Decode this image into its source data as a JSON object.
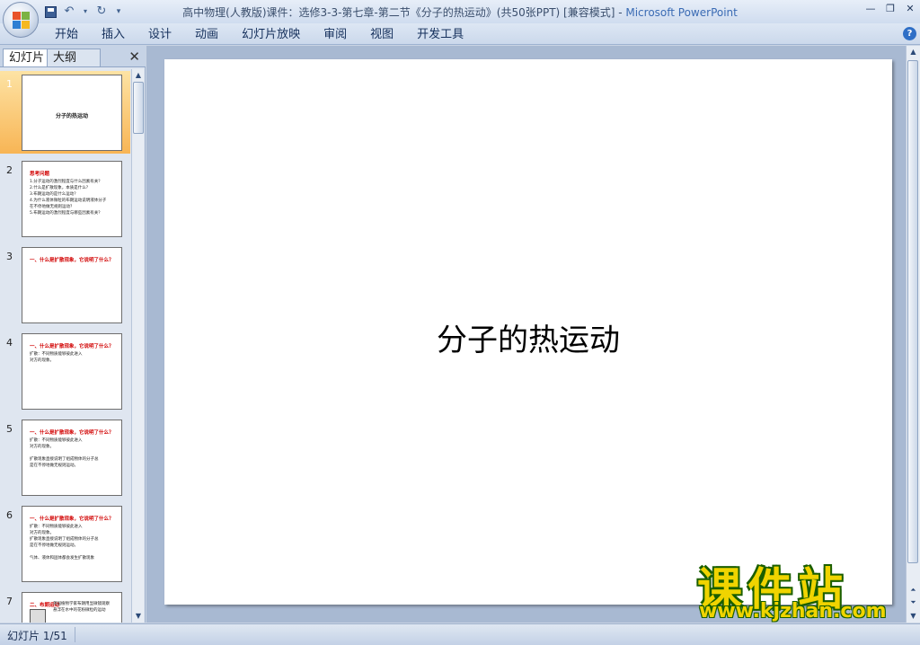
{
  "window": {
    "title_doc": "高中物理(人教版)课件：选修3-3-第七章-第二节《分子的热运动》(共50张PPT) [兼容模式]",
    "title_sep": " - ",
    "title_app": "Microsoft PowerPoint",
    "minimize": "—",
    "restore": "❐",
    "close": "✕"
  },
  "ribbon": {
    "tabs": [
      "开始",
      "插入",
      "设计",
      "动画",
      "幻灯片放映",
      "审阅",
      "视图",
      "开发工具"
    ],
    "help": "?"
  },
  "pane": {
    "tab_slides": "幻灯片",
    "tab_outline": "大纲",
    "close": "✕"
  },
  "slides": [
    {
      "num": "1",
      "selected": true,
      "title": "分子的热运动"
    },
    {
      "num": "2",
      "red": "思考问题",
      "lines": [
        "1.分子运动的激烈程度与什么因素有关？",
        "2.什么是扩散现象，本质是什么？",
        "3.布朗运动的是什么运动？",
        "4.为什么液体微粒的布朗运动说明液体分子",
        "  在不停地做无规则运动？",
        "5.布朗运动的激烈程度与哪些因素有关？"
      ]
    },
    {
      "num": "3",
      "red": "一、什么是扩散现象，它说明了什么？",
      "lines": []
    },
    {
      "num": "4",
      "red": "一、什么是扩散现象，它说明了什么？",
      "lines": [
        "   扩散：不同物质能够彼此进入",
        "对方的现象。"
      ]
    },
    {
      "num": "5",
      "red": "一、什么是扩散现象，它说明了什么？",
      "lines": [
        "   扩散：不同物质能够彼此进入",
        "对方的现象。",
        "",
        "    扩散现象直接说明了组成物体的分子总",
        "是在不停地做无规则运动。"
      ]
    },
    {
      "num": "6",
      "red": "一、什么是扩散现象，它说明了什么？",
      "lines": [
        "   扩散：不同物质能够彼此进入",
        "对方的现象。",
        "   扩散现象直接说明了组成物体的分子总",
        "是在不停地做无规则运动。",
        "",
        "    气体、液体和固体都会发生扩散现象"
      ]
    },
    {
      "num": "7",
      "red": "二、布朗运动",
      "lines": [
        "        英国植物学家布朗用显微镜观察",
        "        悬浮在水中的花粉微粒的运动"
      ]
    }
  ],
  "main_slide": {
    "title": "分子的热运动"
  },
  "watermark": {
    "cn": "课件站",
    "url": "www.kjzhan.com"
  },
  "status": {
    "slide_info": "幻灯片 1/51"
  },
  "colors": {
    "accent": "#f8b555",
    "slide_red": "#d10000",
    "ribbon": "#cbd8eb"
  },
  "icons": [
    "office-button",
    "save-icon",
    "undo-icon",
    "redo-icon",
    "qat-dropdown-icon",
    "help-icon"
  ]
}
